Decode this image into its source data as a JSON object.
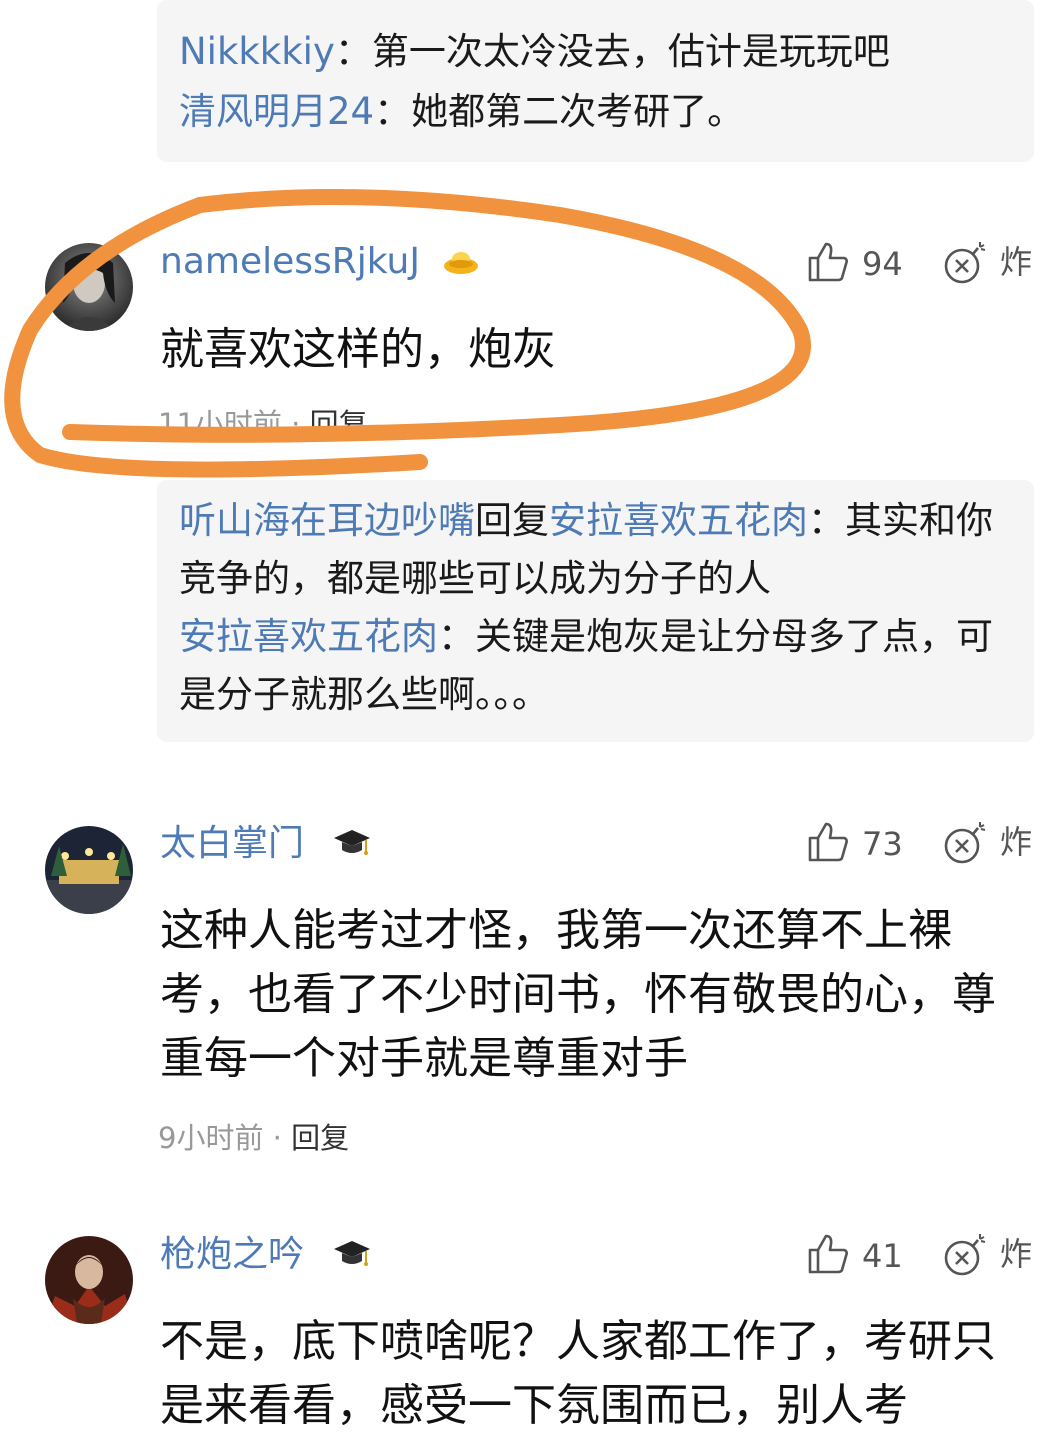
{
  "top_replies": [
    {
      "nick": "Nikkkkiy",
      "sep": "：",
      "text": "第一次太冷没去，估计是玩玩吧"
    },
    {
      "nick": "清风明月24",
      "sep": "：",
      "text": "她都第二次考研了。"
    }
  ],
  "comments": [
    {
      "username": "namelessRjkuJ",
      "badge": "gold-ingot-icon",
      "likes": "94",
      "bomb_label": "炸",
      "text": "就喜欢这样的，炮灰",
      "time": "11小时前",
      "dot": " · ",
      "reply_label": "回复",
      "replies": [
        {
          "nick": "听山海在耳边吵嘴",
          "mid": "回复",
          "target": "安拉喜欢五花肉",
          "sep": "：",
          "text": "其实和你竞争的，都是哪些可以成为分子的人"
        },
        {
          "nick": "安拉喜欢五花肉",
          "sep": "：",
          "text": "关键是炮灰是让分母多了点，可是分子就那么些啊。。。"
        }
      ]
    },
    {
      "username": "太白掌门",
      "badge": "graduation-cap-icon",
      "likes": "73",
      "bomb_label": "炸",
      "text": "这种人能考过才怪，我第一次还算不上裸考，也看了不少时间书，怀有敬畏的心，尊重每一个对手就是尊重对手",
      "time": "9小时前",
      "dot": " · ",
      "reply_label": "回复"
    },
    {
      "username": "枪炮之吟",
      "badge": "graduation-cap-icon",
      "likes": "41",
      "bomb_label": "炸",
      "text": "不是，底下喷啥呢？人家都工作了，考研只是来看看，感受一下氛围而已，别人考"
    }
  ],
  "colors": {
    "nick_blue": "#4e7ab5",
    "highlight_orange": "#f0923e",
    "reply_bg": "#f5f5f5"
  }
}
